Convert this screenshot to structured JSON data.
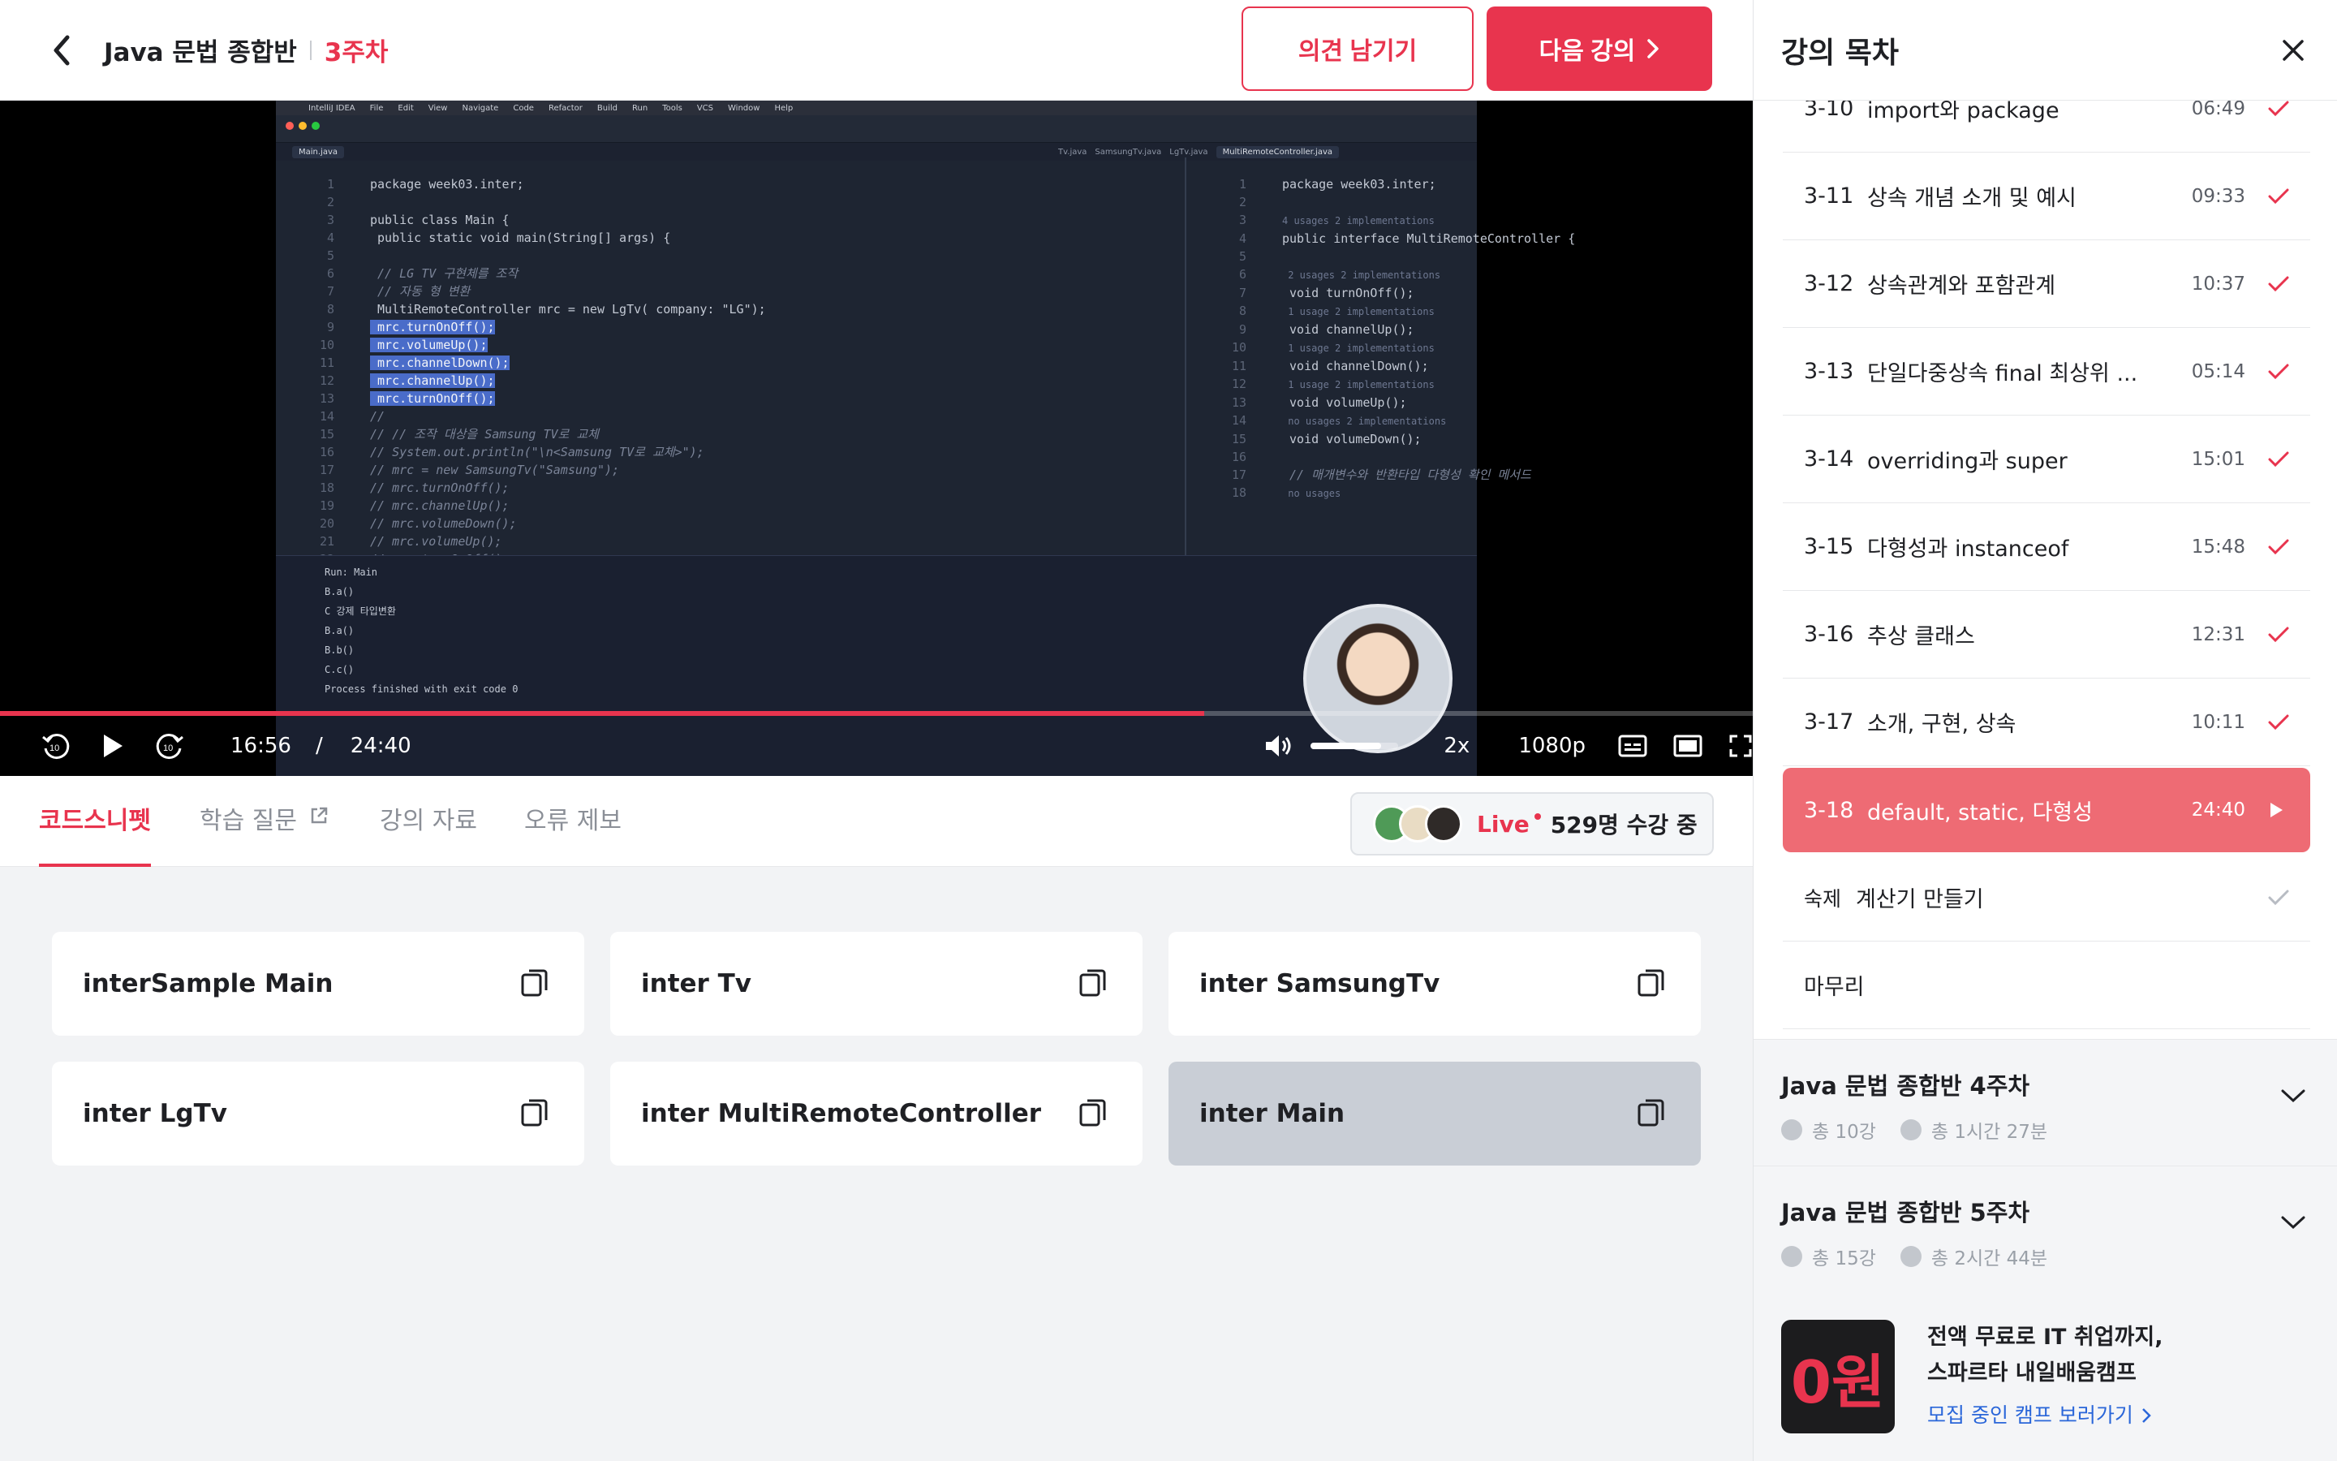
{
  "header": {
    "course_title": "Java 문법 종합반",
    "week": "3주차",
    "feedback_button": "의견 남기기",
    "next_button": "다음 강의"
  },
  "player": {
    "current_time": "16:56",
    "time_separator": "/",
    "duration": "24:40",
    "speed": "2x",
    "quality": "1080p",
    "progress_fraction": 0.687,
    "volume_fraction": 0.8
  },
  "ide": {
    "menu": [
      "IntelliJ IDEA",
      "File",
      "Edit",
      "View",
      "Navigate",
      "Code",
      "Refactor",
      "Build",
      "Run",
      "Tools",
      "VCS",
      "Window",
      "Help"
    ],
    "tabs_left": [
      "Main.java"
    ],
    "tabs_right": [
      "Tv.java",
      "SamsungTv.java",
      "LgTv.java",
      "MultiRemoteController.java"
    ],
    "code_left": [
      "package week03.inter;",
      "",
      "public class Main {",
      "    public static void main(String[] args) {",
      "",
      "        // LG TV 구현체를 조작",
      "        // 자동 형 변환",
      "        MultiRemoteController mrc = new LgTv( company: \"LG\");",
      "        mrc.turnOnOff();",
      "        mrc.volumeUp();",
      "        mrc.channelDown();",
      "        mrc.channelUp();",
      "        mrc.turnOnOff();",
      "//",
      "//          // 조작 대상을 Samsung TV로 교체",
      "//          System.out.println(\"\\n<Samsung TV로 교체>\");",
      "//          mrc = new SamsungTv(\"Samsung\");",
      "//          mrc.turnOnOff();",
      "//          mrc.channelUp();",
      "//          mrc.volumeDown();",
      "//          mrc.volumeUp();",
      "//          mrc.turnOnOff();"
    ],
    "code_right": [
      "package week03.inter;",
      "",
      "4 usages  2 implementations",
      "public interface MultiRemoteController {",
      "",
      "    2 usages  2 implementations",
      "    void turnOnOff();",
      "    1 usage  2 implementations",
      "    void channelUp();",
      "    1 usage  2 implementations",
      "    void channelDown();",
      "    1 usage  2 implementations",
      "    void volumeUp();",
      "    no usages  2 implementations",
      "    void volumeDown();",
      "",
      "    // 매개변수와 반환타입 다형성 확인 메서드",
      "    no usages"
    ],
    "run_output": [
      "B.a()",
      "C 강제 타입변환",
      "B.a()",
      "B.b()",
      "C.c()",
      "Process finished with exit code 0"
    ],
    "run_label": "Run:",
    "run_tab": "Main"
  },
  "tabs": [
    {
      "label": "코드스니펫",
      "active": true
    },
    {
      "label": "학습 질문",
      "active": false
    },
    {
      "label": "강의 자료",
      "active": false
    },
    {
      "label": "오류 제보",
      "active": false
    }
  ],
  "live": {
    "word": "Live",
    "viewers": "529명 수강 중"
  },
  "snippets": [
    {
      "name": "interSample Main",
      "active": false
    },
    {
      "name": "inter Tv",
      "active": false
    },
    {
      "name": "inter SamsungTv",
      "active": false
    },
    {
      "name": "inter LgTv",
      "active": false
    },
    {
      "name": "inter MultiRemoteController",
      "active": false
    },
    {
      "name": "inter Main",
      "active": true
    }
  ],
  "sidebar": {
    "title": "강의 목차",
    "lessons": [
      {
        "num": "3-10",
        "title": "import와 package",
        "duration": "06:49",
        "done": true
      },
      {
        "num": "3-11",
        "title": "상속 개념 소개 및 예시",
        "duration": "09:33",
        "done": true
      },
      {
        "num": "3-12",
        "title": "상속관계와 포함관계",
        "duration": "10:37",
        "done": true
      },
      {
        "num": "3-13",
        "title": "단일다중상속 final 최상위 ...",
        "duration": "05:14",
        "done": true
      },
      {
        "num": "3-14",
        "title": "overriding과 super",
        "duration": "15:01",
        "done": true
      },
      {
        "num": "3-15",
        "title": "다형성과 instanceof",
        "duration": "15:48",
        "done": true
      },
      {
        "num": "3-16",
        "title": "추상 클래스",
        "duration": "12:31",
        "done": true
      },
      {
        "num": "3-17",
        "title": "소개, 구현, 상속",
        "duration": "10:11",
        "done": true
      },
      {
        "num": "3-18",
        "title": "default, static, 다형성",
        "duration": "24:40",
        "done": false,
        "active": true
      },
      {
        "num": "숙제",
        "title": "계산기 만들기",
        "duration": "",
        "done": true,
        "homework": true
      },
      {
        "num": "",
        "title": "마무리",
        "duration": "",
        "done": false
      }
    ],
    "weeks": [
      {
        "title": "Java 문법 종합반 4주차",
        "count": "총 10강",
        "time": "총 1시간 27분"
      },
      {
        "title": "Java 문법 종합반 5주차",
        "count": "총 15강",
        "time": "총 2시간 44분"
      }
    ],
    "promo": {
      "badge": "0원",
      "line1": "전액 무료로 IT 취업까지,",
      "line2": "스파르타 내일배움캠프",
      "link": "모집 중인 캠프 보러가기"
    }
  },
  "colors": {
    "accent": "#e8344e",
    "active_lesson": "#ee6b74",
    "link": "#2a66d9"
  }
}
